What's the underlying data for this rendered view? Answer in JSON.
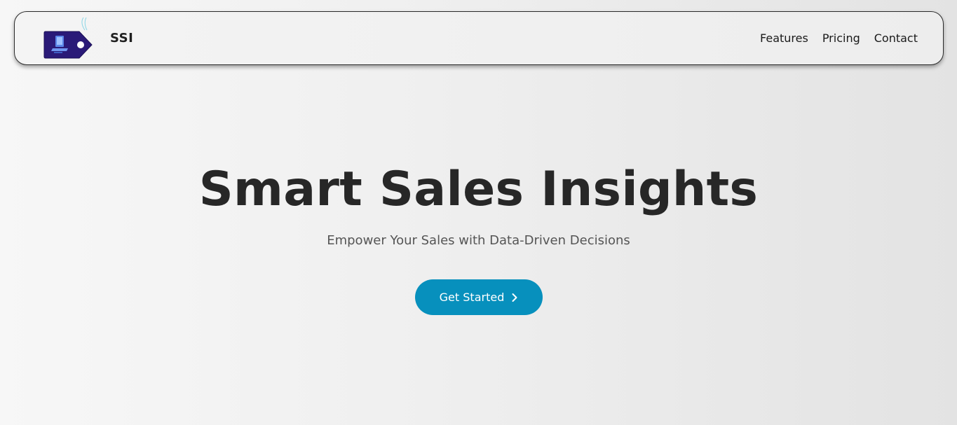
{
  "navbar": {
    "logo_icon": "price-tag-laptop-icon",
    "brand": "SSI",
    "links": [
      {
        "label": "Features"
      },
      {
        "label": "Pricing"
      },
      {
        "label": "Contact"
      }
    ]
  },
  "hero": {
    "title": "Smart Sales Insights",
    "subtitle": "Empower Your Sales with Data-Driven Decisions",
    "cta_label": "Get Started",
    "cta_icon": "chevron-right-icon"
  },
  "colors": {
    "accent": "#0790bd",
    "logo_tag": "#2a1a78",
    "text_dark": "#272727"
  }
}
